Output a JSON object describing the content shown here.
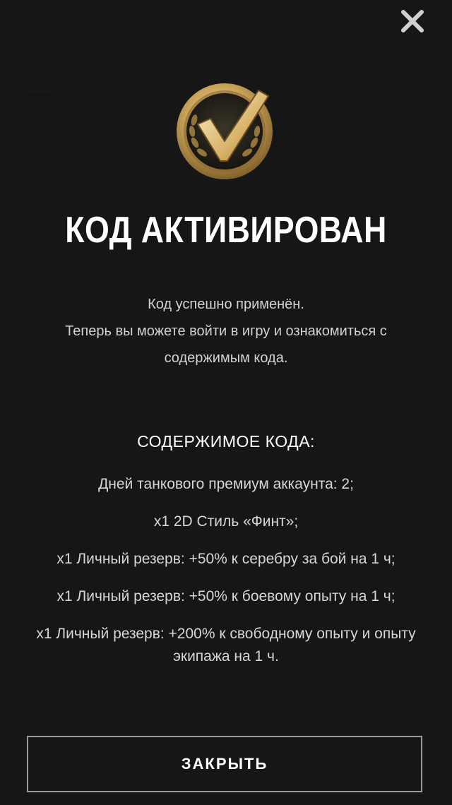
{
  "modal": {
    "title": "КОД АКТИВИРОВАН",
    "description": [
      "Код успешно применён.",
      "Теперь вы можете войти в игру и ознакомиться с содержимым кода."
    ],
    "contents_title": "СОДЕРЖИМОЕ КОДА:",
    "contents_items": [
      "Дней танкового премиум аккаунта: 2;",
      "x1 2D Стиль «Финт»;",
      "x1 Личный резерв: +50% к серебру за бой на 1 ч;",
      "x1 Личный резерв: +50% к боевому опыту на 1 ч;",
      "x1 Личный резерв: +200% к свободному опыту и опыту экипажа на 1 ч."
    ],
    "close_button_label": "ЗАКРЫТЬ",
    "close_icon": "close-icon",
    "badge_icon": "checkmark-badge-icon"
  },
  "colors": {
    "background": "#161616",
    "text_primary": "#ffffff",
    "text_secondary": "#d2d2d2",
    "badge_gold": "#c9a35a",
    "button_border": "#9a9a9a"
  }
}
